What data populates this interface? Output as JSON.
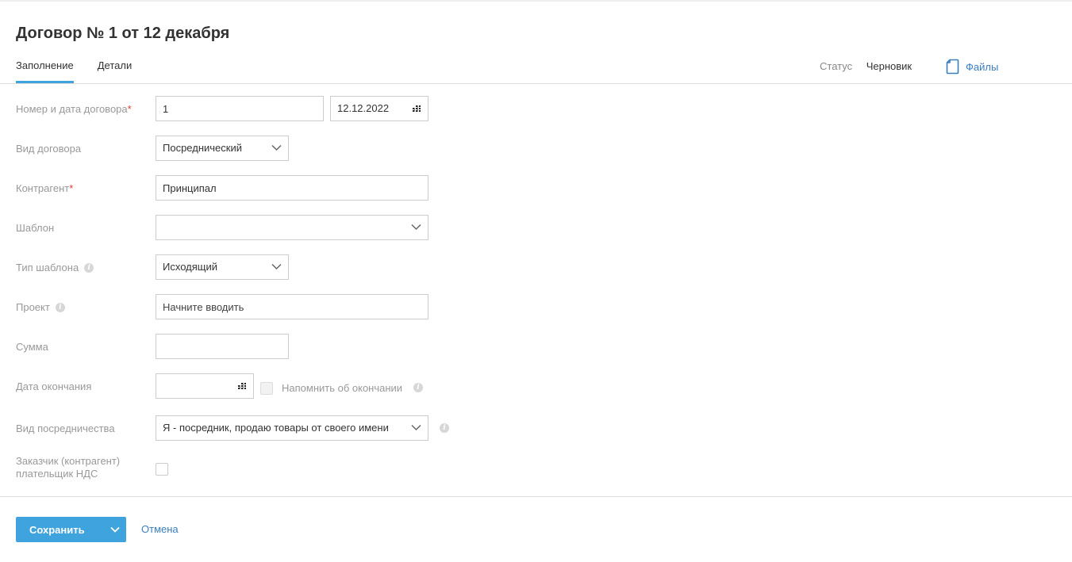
{
  "header": {
    "title": "Договор № 1 от 12 декабря",
    "tabs": [
      {
        "label": "Заполнение",
        "active": true
      },
      {
        "label": "Детали",
        "active": false
      }
    ],
    "status_label": "Статус",
    "status_value": "Черновик",
    "files_label": "Файлы"
  },
  "form": {
    "number_date": {
      "label": "Номер и дата договора",
      "required_mark": "*",
      "number_value": "1",
      "date_value": "12.12.2022"
    },
    "contract_type": {
      "label": "Вид договора",
      "value": "Посреднический"
    },
    "counterparty": {
      "label": "Контрагент",
      "required_mark": "*",
      "value": "Принципал"
    },
    "template": {
      "label": "Шаблон",
      "value": ""
    },
    "template_type": {
      "label": "Тип шаблона",
      "value": "Исходящий"
    },
    "project": {
      "label": "Проект",
      "placeholder": "Начните вводить"
    },
    "amount": {
      "label": "Сумма",
      "value": ""
    },
    "end_date": {
      "label": "Дата окончания",
      "value": "",
      "remind_label": "Напомнить об окончании"
    },
    "mediation_type": {
      "label": "Вид посредничества",
      "value": "Я - посредник, продаю товары от своего имени"
    },
    "vat_payer": {
      "label_line1": "Заказчик (контрагент)",
      "label_line2": "плательщик НДС",
      "checked": false
    }
  },
  "footer": {
    "save_label": "Сохранить",
    "cancel_label": "Отмена"
  },
  "colors": {
    "accent": "#3fa3de",
    "link": "#3a7ebf",
    "required": "#e53935",
    "label": "#999999"
  }
}
